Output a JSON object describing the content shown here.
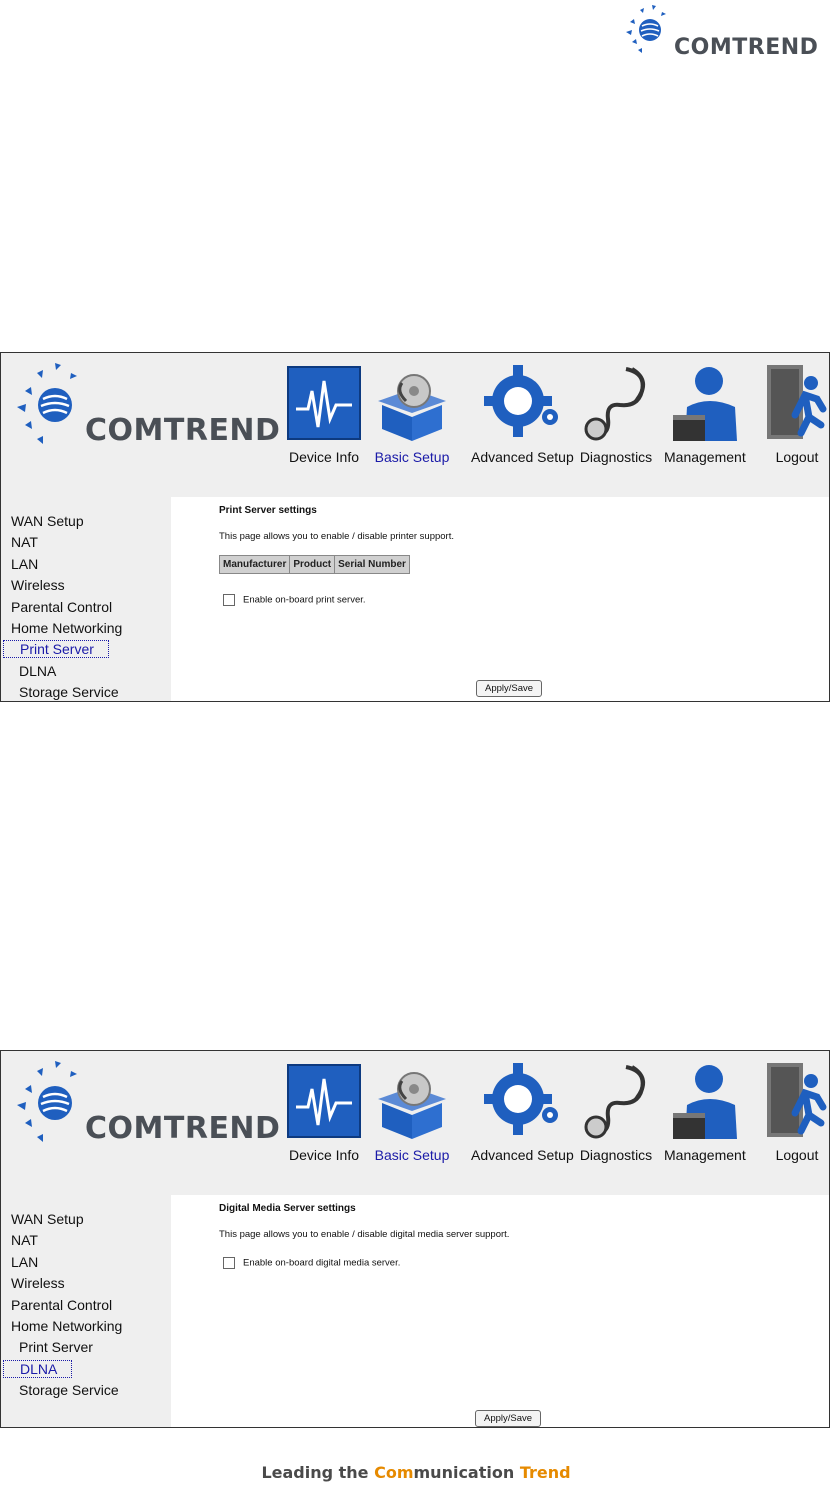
{
  "brand": {
    "name": "COMTREND",
    "accent": "#1f5fbf",
    "dark": "#4a4f56"
  },
  "nav": [
    {
      "label": "Device Info",
      "icon": "device-info-icon"
    },
    {
      "label": "Basic Setup",
      "icon": "basic-setup-icon",
      "active": true
    },
    {
      "label": "Advanced Setup",
      "icon": "advanced-setup-icon"
    },
    {
      "label": "Diagnostics",
      "icon": "diagnostics-icon"
    },
    {
      "label": "Management",
      "icon": "management-icon"
    },
    {
      "label": "Logout",
      "icon": "logout-icon"
    }
  ],
  "sidebar": [
    "WAN Setup",
    "NAT",
    "LAN",
    "Wireless",
    "Parental Control",
    "Home Networking",
    "Print Server",
    "DLNA",
    "Storage Service"
  ],
  "panel1": {
    "active_item": "Print Server",
    "title": "Print Server settings",
    "description": "This page allows you to enable / disable printer support.",
    "table_headers": [
      "Manufacturer",
      "Product",
      "Serial Number"
    ],
    "checkbox_label": "Enable on-board print server.",
    "button": "Apply/Save"
  },
  "panel2": {
    "active_item": "DLNA",
    "title": "Digital Media Server settings",
    "description": "This page allows you to enable / disable digital media server support.",
    "checkbox_label": "Enable on-board digital media server.",
    "button": "Apply/Save"
  },
  "footer": {
    "part1": "Leading the ",
    "accent": "Com",
    "part2": "munication ",
    "accent2": "Trend"
  }
}
